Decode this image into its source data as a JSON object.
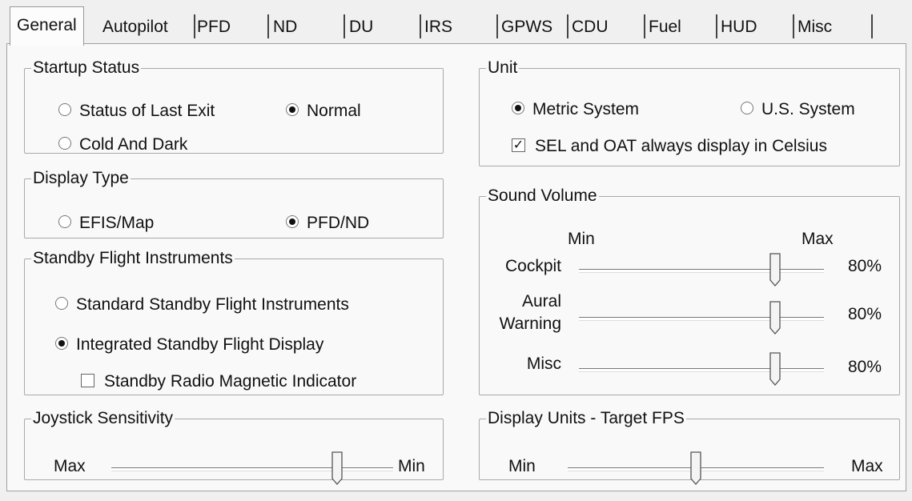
{
  "tabs": [
    "General",
    "Autopilot",
    "PFD",
    "ND",
    "DU",
    "IRS",
    "GPWS",
    "CDU",
    "Fuel",
    "HUD",
    "Misc"
  ],
  "startup_status": {
    "legend": "Startup Status",
    "last_exit": "Status of Last Exit",
    "normal": "Normal",
    "cold_dark": "Cold And Dark",
    "selected": "Normal"
  },
  "display_type": {
    "legend": "Display Type",
    "efis_map": "EFIS/Map",
    "pfd_nd": "PFD/ND",
    "selected": "PFD/ND"
  },
  "standby": {
    "legend": "Standby Flight Instruments",
    "standard": "Standard Standby Flight Instruments",
    "integrated": "Integrated Standby Flight Display",
    "rmi": "Standby Radio Magnetic Indicator",
    "selected": "Integrated Standby Flight Display",
    "rmi_checked": false
  },
  "joystick": {
    "legend": "Joystick Sensitivity",
    "left_label": "Max",
    "right_label": "Min",
    "level": 0.8
  },
  "unit": {
    "legend": "Unit",
    "metric": "Metric System",
    "us": "U.S. System",
    "celsius": "SEL and OAT always display in Celsius",
    "selected": "Metric System",
    "celsius_checked": true
  },
  "sound": {
    "legend": "Sound Volume",
    "min_label": "Min",
    "max_label": "Max",
    "cockpit_label": "Cockpit",
    "cockpit_value": "80%",
    "aural_label_1": "Aural",
    "aural_label_2": "Warning",
    "aural_value": "80%",
    "misc_label": "Misc",
    "misc_value": "80%",
    "levels": [
      0.8,
      0.8,
      0.8
    ]
  },
  "fps": {
    "legend": "Display Units - Target FPS",
    "min_label": "Min",
    "max_label": "Max",
    "level": 0.5
  }
}
